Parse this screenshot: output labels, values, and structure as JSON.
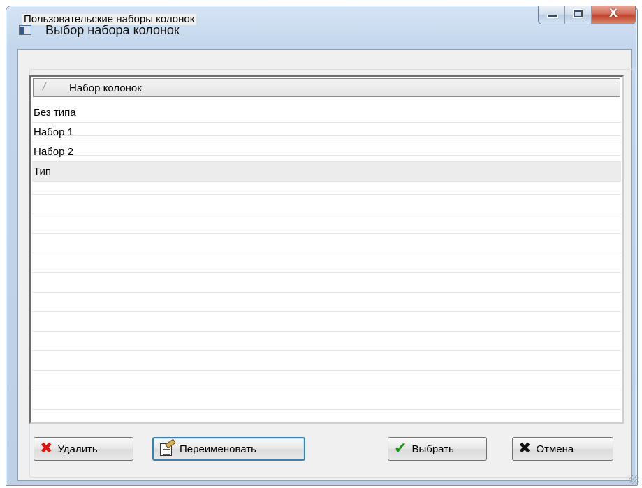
{
  "window": {
    "title": "Выбор набора колонок",
    "close_glyph": "X"
  },
  "group": {
    "label": "Пользовательские наборы колонок"
  },
  "grid": {
    "sort_glyph": "/",
    "columns": [
      "Набор колонок"
    ],
    "rows": [
      "Без типа",
      "Набор 1",
      "Набор 2",
      "Тип"
    ],
    "selected_row": "Тип"
  },
  "buttons": {
    "delete": {
      "label": "Удалить",
      "icon": "delete-x-icon"
    },
    "rename": {
      "label": "Переименовать",
      "icon": "rename-icon"
    },
    "select": {
      "label": "Выбрать",
      "icon": "checkmark-icon"
    },
    "cancel": {
      "label": "Отмена",
      "icon": "cancel-x-icon"
    }
  },
  "colors": {
    "accent_focus": "#3c7fb1",
    "delete_icon": "#e01212",
    "select_icon": "#1a9a1a"
  }
}
